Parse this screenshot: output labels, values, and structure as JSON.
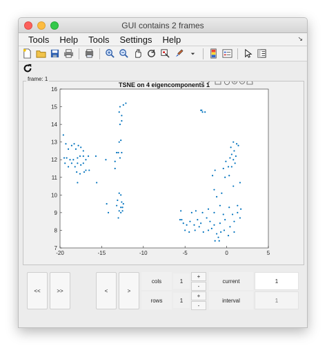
{
  "window": {
    "title": "GUI contains 2 frames"
  },
  "menu": [
    "Tools",
    "Help",
    "Tools",
    "Settings",
    "Help"
  ],
  "toolbar_icons": [
    "new-file-icon",
    "open-folder-icon",
    "save-icon",
    "print-icon",
    "print-preview-icon",
    "zoom-in-icon",
    "zoom-out-icon",
    "pan-icon",
    "rotate-icon",
    "data-cursor-icon",
    "brush-icon",
    "colorbar-icon",
    "legend-icon",
    "pointer-icon",
    "property-editor-icon"
  ],
  "frame": {
    "label": "frame: 1"
  },
  "chart_data": {
    "type": "scatter",
    "title": "TSNE on 4 eigencomponents 1",
    "xlabel": "",
    "ylabel": "",
    "xlim": [
      -20,
      5
    ],
    "ylim": [
      7,
      16
    ],
    "xticks": [
      -20,
      -15,
      -10,
      -5,
      0,
      5
    ],
    "yticks": [
      7,
      8,
      9,
      10,
      11,
      12,
      13,
      14,
      15,
      16
    ],
    "grid": false,
    "color": "#0072bd",
    "points": [
      [
        -19.6,
        13.4
      ],
      [
        -19.3,
        12.9
      ],
      [
        -19.0,
        12.6
      ],
      [
        -18.6,
        12.8
      ],
      [
        -18.3,
        12.9
      ],
      [
        -18.1,
        12.6
      ],
      [
        -17.8,
        12.8
      ],
      [
        -17.5,
        12.7
      ],
      [
        -17.2,
        12.5
      ],
      [
        -19.5,
        12.1
      ],
      [
        -19.2,
        12.1
      ],
      [
        -18.8,
        12.0
      ],
      [
        -18.4,
        12.0
      ],
      [
        -17.9,
        12.1
      ],
      [
        -17.6,
        12.2
      ],
      [
        -17.2,
        12.2
      ],
      [
        -16.9,
        12.0
      ],
      [
        -16.6,
        12.2
      ],
      [
        -15.7,
        12.2
      ],
      [
        -19.4,
        11.8
      ],
      [
        -19.0,
        11.6
      ],
      [
        -18.6,
        11.8
      ],
      [
        -18.2,
        11.6
      ],
      [
        -17.9,
        11.8
      ],
      [
        -17.5,
        11.7
      ],
      [
        -17.2,
        11.8
      ],
      [
        -16.9,
        11.4
      ],
      [
        -16.5,
        11.4
      ],
      [
        -18.0,
        11.3
      ],
      [
        -17.6,
        11.2
      ],
      [
        -17.1,
        11.3
      ],
      [
        -17.9,
        10.7
      ],
      [
        -15.6,
        10.7
      ],
      [
        -12.8,
        15.0
      ],
      [
        -12.4,
        15.1
      ],
      [
        -12.1,
        15.2
      ],
      [
        -12.9,
        14.7
      ],
      [
        -12.6,
        14.5
      ],
      [
        -12.6,
        14.2
      ],
      [
        -12.8,
        14.0
      ],
      [
        -12.7,
        13.1
      ],
      [
        -12.9,
        13.0
      ],
      [
        -12.6,
        12.4
      ],
      [
        -13.0,
        12.4
      ],
      [
        -13.2,
        12.4
      ],
      [
        -12.8,
        12.1
      ],
      [
        -14.5,
        12.0
      ],
      [
        -13.4,
        11.9
      ],
      [
        -13.4,
        11.5
      ],
      [
        -12.9,
        10.1
      ],
      [
        -12.7,
        10.0
      ],
      [
        -12.6,
        9.6
      ],
      [
        -14.4,
        9.5
      ],
      [
        -13.2,
        9.4
      ],
      [
        -12.7,
        9.3
      ],
      [
        -12.5,
        9.3
      ],
      [
        -14.2,
        9.0
      ],
      [
        -12.9,
        9.1
      ],
      [
        -12.7,
        9.0
      ],
      [
        -12.5,
        9.1
      ],
      [
        -13.0,
        8.7
      ],
      [
        -12.4,
        9.5
      ],
      [
        -13.1,
        9.7
      ],
      [
        -3.1,
        14.8
      ],
      [
        -2.9,
        14.7
      ],
      [
        -2.6,
        14.7
      ],
      [
        -3.0,
        14.8
      ],
      [
        0.8,
        13.0
      ],
      [
        1.2,
        12.9
      ],
      [
        0.5,
        12.7
      ],
      [
        0.9,
        12.5
      ],
      [
        1.4,
        12.8
      ],
      [
        0.6,
        12.3
      ],
      [
        1.1,
        12.2
      ],
      [
        0.4,
        12.1
      ],
      [
        0.8,
        12.0
      ],
      [
        -0.1,
        11.9
      ],
      [
        1.0,
        11.8
      ],
      [
        0.6,
        11.6
      ],
      [
        0.2,
        11.6
      ],
      [
        -0.4,
        11.5
      ],
      [
        -1.4,
        11.4
      ],
      [
        -1.7,
        11.1
      ],
      [
        0.3,
        11.1
      ],
      [
        -0.2,
        11.0
      ],
      [
        1.6,
        10.7
      ],
      [
        0.8,
        10.5
      ],
      [
        -1.5,
        10.3
      ],
      [
        -0.6,
        10.1
      ],
      [
        -1.2,
        9.9
      ],
      [
        1.3,
        9.4
      ],
      [
        -2.2,
        9.2
      ],
      [
        -0.8,
        9.4
      ],
      [
        0.3,
        9.3
      ],
      [
        1.7,
        9.2
      ],
      [
        -5.5,
        9.1
      ],
      [
        -4.2,
        9.0
      ],
      [
        -3.7,
        9.1
      ],
      [
        -2.9,
        9.0
      ],
      [
        -1.5,
        9.0
      ],
      [
        -0.4,
        8.9
      ],
      [
        0.7,
        8.9
      ],
      [
        1.3,
        9.0
      ],
      [
        -5.4,
        8.6
      ],
      [
        -5.2,
        8.4
      ],
      [
        -4.8,
        8.3
      ],
      [
        -4.4,
        8.5
      ],
      [
        -3.9,
        8.3
      ],
      [
        -3.5,
        8.6
      ],
      [
        -3.1,
        8.4
      ],
      [
        -2.4,
        8.7
      ],
      [
        -2.0,
        8.5
      ],
      [
        -1.5,
        8.3
      ],
      [
        -0.8,
        8.4
      ],
      [
        -0.2,
        8.6
      ],
      [
        0.4,
        8.2
      ],
      [
        0.9,
        8.5
      ],
      [
        1.6,
        8.7
      ],
      [
        -5.0,
        8.0
      ],
      [
        -4.5,
        7.9
      ],
      [
        -3.8,
        8.0
      ],
      [
        -3.3,
        8.2
      ],
      [
        -2.8,
        7.9
      ],
      [
        -2.2,
        8.0
      ],
      [
        -1.8,
        8.1
      ],
      [
        -1.2,
        7.8
      ],
      [
        -0.7,
        7.9
      ],
      [
        -0.3,
        8.0
      ],
      [
        0.2,
        7.7
      ],
      [
        0.9,
        7.9
      ],
      [
        -1.0,
        7.6
      ],
      [
        -1.4,
        7.4
      ],
      [
        -0.9,
        7.4
      ],
      [
        -5.6,
        8.6
      ]
    ]
  },
  "controls": {
    "prev_prev": "<<",
    "next_next": ">>",
    "prev": "<",
    "next": ">",
    "cols_label": "cols",
    "cols_value": "1",
    "rows_label": "rows",
    "rows_value": "1",
    "plus": "+",
    "minus": "-",
    "current_label": "current",
    "current_value": "1",
    "interval_label": "interval",
    "interval_value": "1"
  }
}
